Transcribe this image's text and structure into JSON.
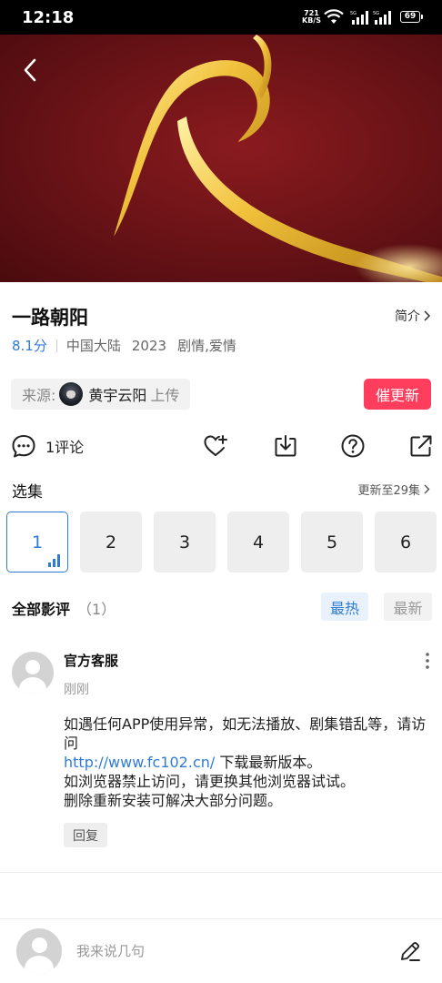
{
  "status_bar": {
    "time": "12:18",
    "net_speed_value": "721",
    "net_speed_unit": "KB/S",
    "battery": "69"
  },
  "video": {
    "title": "一路朝阳",
    "intro_label": "简介",
    "score": "8.1分",
    "region": "中国大陆",
    "year": "2023",
    "genres": "剧情,爱情"
  },
  "source": {
    "label": "来源:",
    "uploader": "黄宇云阳",
    "action": "上传"
  },
  "urge_button": "催更新",
  "actions": {
    "comment_count": "1评论"
  },
  "episodes": {
    "label": "选集",
    "update_status": "更新至29集",
    "items": [
      "1",
      "2",
      "3",
      "4",
      "5",
      "6"
    ],
    "active_index": 0
  },
  "reviews": {
    "title": "全部影评",
    "count": "（1）",
    "sort_hot": "最热",
    "sort_new": "最新"
  },
  "comment": {
    "author": "官方客服",
    "time": "刚刚",
    "line1": "如遇任何APP使用异常，如无法播放、剧集错乱等，请访问",
    "link": "http://www.fc102.cn/",
    "line2_suffix": " 下载最新版本。",
    "line3": "如浏览器禁止访问，请更换其他浏览器试试。",
    "line4": "删除重新安装可解决大部分问题。",
    "reply_label": "回复"
  },
  "compose": {
    "placeholder": "我来说几句"
  },
  "colors": {
    "accent_blue": "#2f7bd6",
    "urge_red": "#ff3e5e",
    "hero_red": "#6e1418",
    "gold": "#e9b52a"
  },
  "icons": [
    "back-arrow-icon",
    "wifi-icon",
    "signal-icon",
    "battery-icon",
    "chevron-right-icon",
    "comment-bubble-icon",
    "heart-plus-icon",
    "download-icon",
    "help-icon",
    "share-icon",
    "bars-playing-icon",
    "more-vertical-icon",
    "pen-icon"
  ]
}
